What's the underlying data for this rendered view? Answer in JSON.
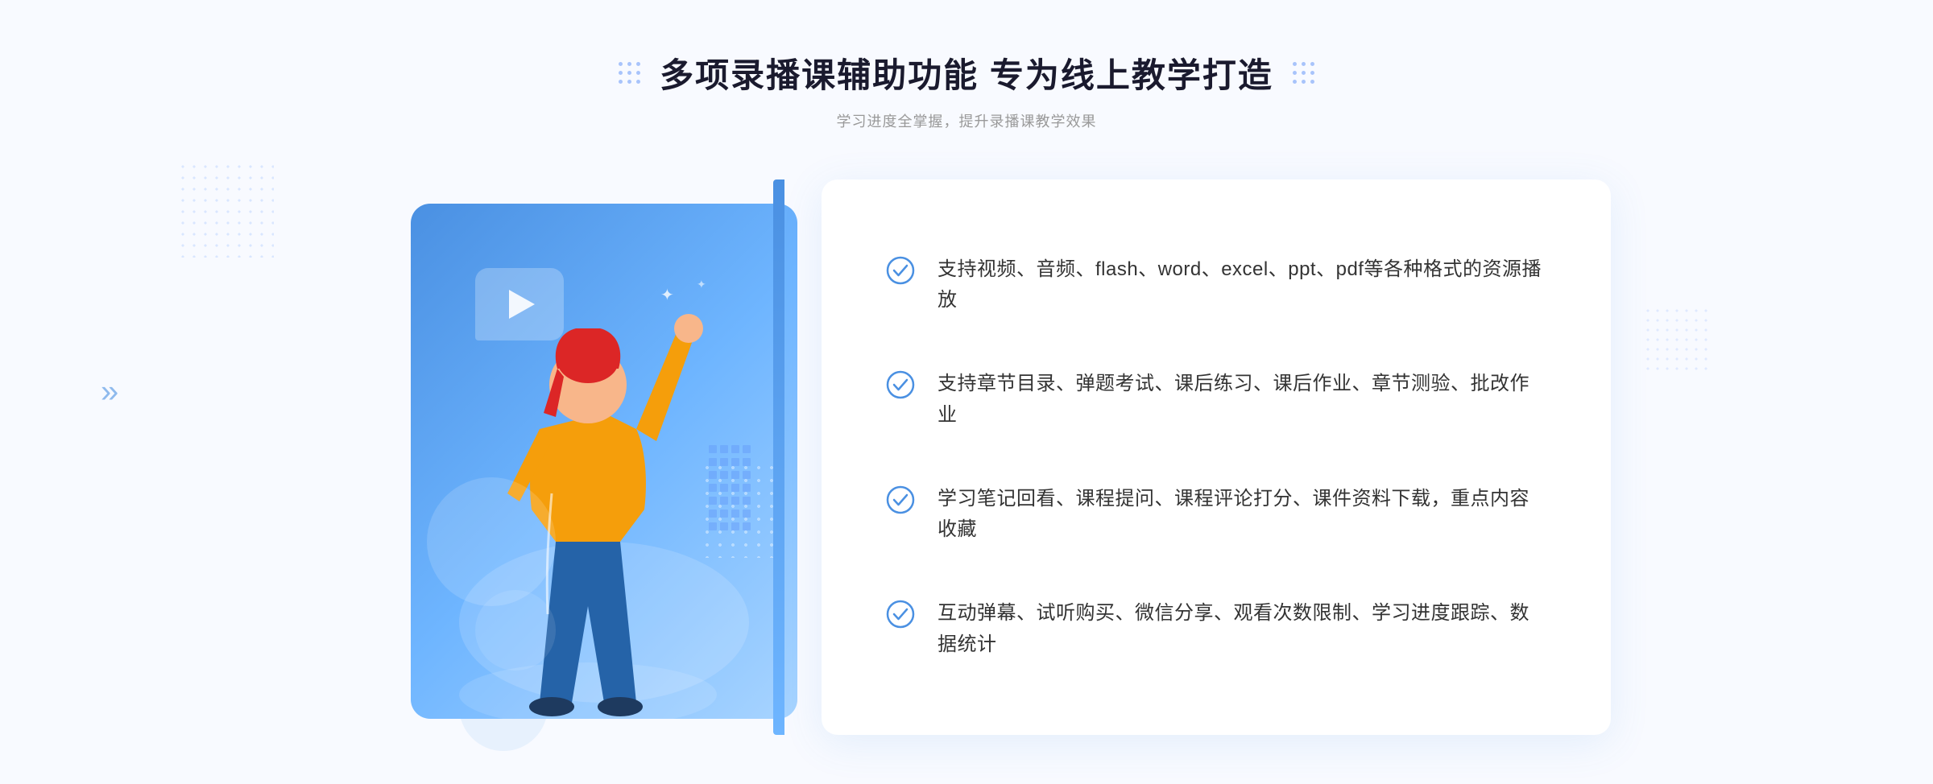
{
  "page": {
    "background": "#f8faff"
  },
  "header": {
    "main_title": "多项录播课辅助功能 专为线上教学打造",
    "subtitle": "学习进度全掌握，提升录播课教学效果",
    "title_dots_aria": "decorative dots"
  },
  "features": [
    {
      "id": 1,
      "text": "支持视频、音频、flash、word、excel、ppt、pdf等各种格式的资源播放"
    },
    {
      "id": 2,
      "text": "支持章节目录、弹题考试、课后练习、课后作业、章节测验、批改作业"
    },
    {
      "id": 3,
      "text": "学习笔记回看、课程提问、课程评论打分、课件资料下载，重点内容收藏"
    },
    {
      "id": 4,
      "text": "互动弹幕、试听购买、微信分享、观看次数限制、学习进度跟踪、数据统计"
    }
  ],
  "icons": {
    "check_circle": "check-circle-icon",
    "arrow_left": "»",
    "play": "play-icon"
  },
  "colors": {
    "primary_blue": "#4a90e2",
    "light_blue": "#6eb5ff",
    "text_dark": "#333333",
    "text_gray": "#999999",
    "check_color": "#4a90e2"
  }
}
